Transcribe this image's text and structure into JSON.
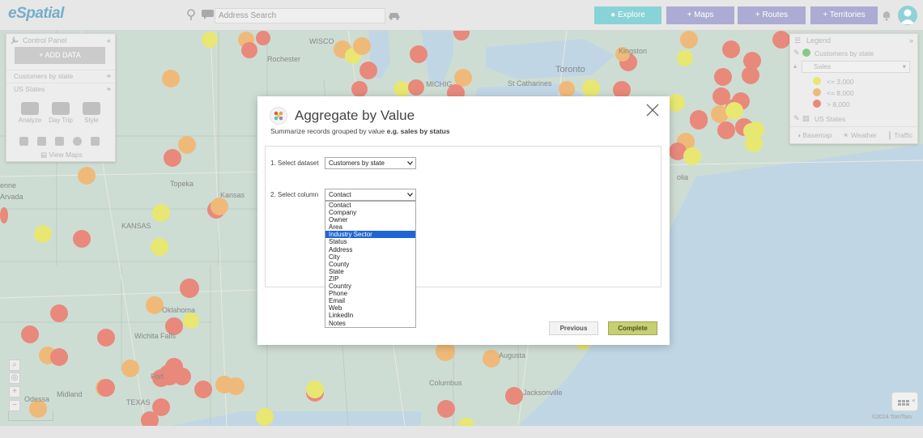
{
  "app": {
    "logo": "eSpatial"
  },
  "topbar": {
    "search_placeholder": "Address Search",
    "explore_label": "Explore",
    "maps_label": "+ Maps",
    "routes_label": "+ Routes",
    "territories_label": "+ Territories"
  },
  "control_panel": {
    "title": "Control Panel",
    "add_data_label": "ADD DATA",
    "layers": [
      {
        "label": "Customers by state"
      },
      {
        "label": "US States"
      }
    ],
    "tools": [
      {
        "label": "Analyze",
        "icon": "analyze-icon"
      },
      {
        "label": "Day Trip",
        "icon": "car-icon"
      },
      {
        "label": "Style",
        "icon": "style-icon"
      }
    ],
    "view_maps_label": "View Maps"
  },
  "legend": {
    "title": "Legend",
    "layer_label": "Customers by state",
    "select_value": "Sales",
    "items": [
      {
        "label": "<= 3,000",
        "color": "#dede3c"
      },
      {
        "label": "<= 8,000",
        "color": "#e9a046"
      },
      {
        "label": "> 8,000",
        "color": "#e05c4a"
      }
    ],
    "states_label": "US States",
    "footer": [
      {
        "label": "Basemap",
        "icon": "basemap-icon"
      },
      {
        "label": "Weather",
        "icon": "weather-icon"
      },
      {
        "label": "Traffic",
        "icon": "traffic-icon"
      }
    ]
  },
  "map": {
    "labels": {
      "wisconsin": "WISCO",
      "rochester": "Rochester",
      "michigan": "MICHIG",
      "toronto": "Toronto",
      "kingston": "Kingston",
      "st_catharines": "St Catharines",
      "kansas_state": "KANSAS",
      "topeka": "Topeka",
      "kansas_city": "Kansas",
      "oklahoma": "Oklahoma",
      "wichita_falls": "Wichita Falls",
      "fort_worth": "Fort",
      "texas": "TEXAS",
      "midland": "Midland",
      "odessa": "Odessa",
      "augusta": "Augusta",
      "columbus": "Columbus",
      "jacksonville": "Jacksonville",
      "cheyenne": "enne",
      "arvada": "Arvada",
      "nolia": "olia"
    },
    "copyright": "©2024 TomTom"
  },
  "modal": {
    "title": "Aggregate by Value",
    "subtitle_prefix": "Summarize records grouped by value",
    "subtitle_example": "e.g. sales by status",
    "step1_label": "1. Select dataset",
    "dataset_value": "Customers by state",
    "step2_label": "2. Select column",
    "column_value": "Contact",
    "column_options": [
      "Contact",
      "Company",
      "Owner",
      "Area",
      "Industry Sector",
      "Status",
      "Address",
      "City",
      "County",
      "State",
      "ZIP",
      "Country",
      "Phone",
      "Email",
      "Web",
      "LinkedIn",
      "Notes"
    ],
    "highlighted_option": "Industry Sector",
    "previous_label": "Previous",
    "complete_label": "Complete"
  }
}
